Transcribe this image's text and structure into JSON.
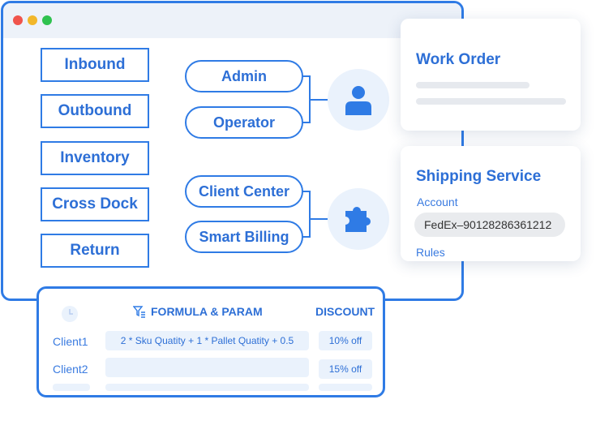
{
  "modules": [
    "Inbound",
    "Outbound",
    "Inventory",
    "Cross Dock",
    "Return"
  ],
  "roles": {
    "user_group": [
      "Admin",
      "Operator"
    ],
    "billing_group": [
      "Client Center",
      "Smart Billing"
    ]
  },
  "icons": {
    "user": "user-icon",
    "puzzle": "puzzle-icon",
    "clock": "clock-icon",
    "filter": "filter-icon"
  },
  "work_order": {
    "title": "Work Order"
  },
  "shipping": {
    "title": "Shipping Service",
    "account_label": "Account",
    "account_value": "FedEx–90128286361212",
    "rules_label": "Rules"
  },
  "billing": {
    "formula_header": "FORMULA & PARAM",
    "discount_header": "DISCOUNT",
    "rows": [
      {
        "client": "Client1",
        "formula": "2 * Sku Quatity + 1 * Pallet Quatity + 0.5",
        "discount": "10% off"
      },
      {
        "client": "Client2",
        "formula": "",
        "discount": "15% off"
      }
    ]
  },
  "colors": {
    "accent": "#2f7be5",
    "text_blue": "#2d6fd6",
    "light_blue": "#eaf2fc",
    "titlebar": "#edf2f9",
    "dot_red": "#f0544c",
    "dot_yellow": "#f2b72a",
    "dot_green": "#2fc24f"
  }
}
